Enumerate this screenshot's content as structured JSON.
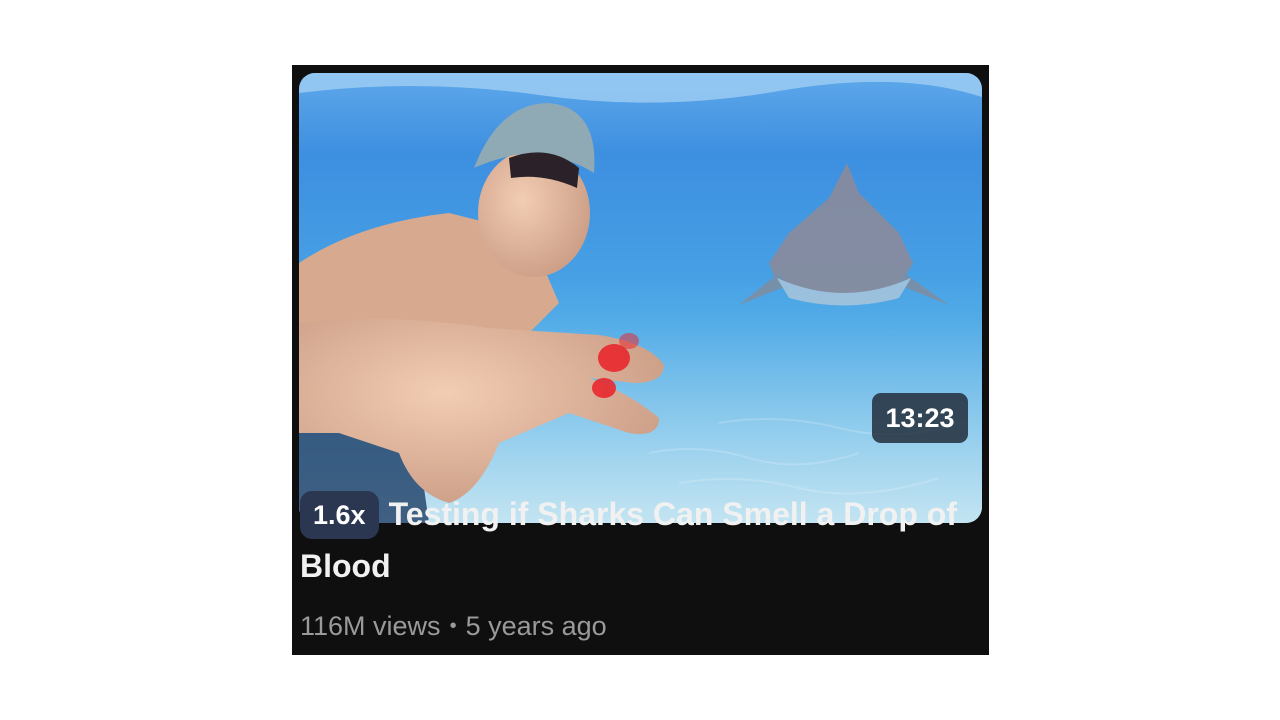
{
  "video": {
    "duration": "13:23",
    "speed_badge": "1.6x",
    "title": "Testing if Sharks Can Smell a Drop of Blood",
    "views": "116M views",
    "separator": "•",
    "age": "5 years ago"
  }
}
